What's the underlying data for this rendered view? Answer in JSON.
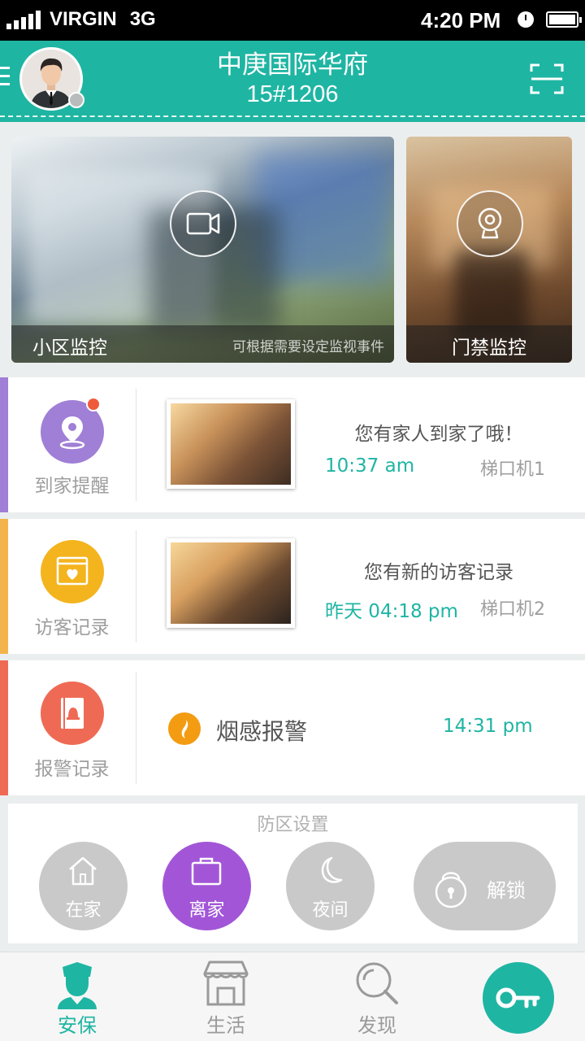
{
  "status_bar": {
    "carrier": "VIRGIN",
    "network": "3G",
    "time": "4:20 PM"
  },
  "header": {
    "title": "中庚国际华府",
    "subtitle": "15#1206"
  },
  "monitors": [
    {
      "label": "小区监控",
      "hint": "可根据需要设定监视事件"
    },
    {
      "label": "门禁监控"
    }
  ],
  "records": [
    {
      "category": "到家提醒",
      "message": "您有家人到家了哦！",
      "time": "10:37 am",
      "location": "梯口机1",
      "color": "#a07fd6",
      "stripe": "#a07fd6",
      "has_badge": true
    },
    {
      "category": "访客记录",
      "message": "您有新的访客记录",
      "time": "昨天 04:18 pm",
      "location": "梯口机2",
      "color": "#f4b41e",
      "stripe": "#f4b44c"
    },
    {
      "category": "报警记录",
      "message": "烟感报警",
      "time": "14:31 pm",
      "color": "#ef6a55",
      "stripe": "#ef6a55",
      "alarm_icon_color": "#f39c12"
    }
  ],
  "zone": {
    "title": "防区设置",
    "buttons": [
      {
        "label": "在家",
        "icon": "house-icon",
        "active": false
      },
      {
        "label": "离家",
        "icon": "bag-icon",
        "active": true
      },
      {
        "label": "夜间",
        "icon": "moon-icon",
        "active": false
      }
    ],
    "unlock_label": "解锁"
  },
  "tabs": [
    {
      "label": "安保",
      "icon": "guard-icon",
      "active": true
    },
    {
      "label": "生活",
      "icon": "shop-icon"
    },
    {
      "label": "发现",
      "icon": "search-icon"
    }
  ],
  "key_button": {
    "icon": "key-icon"
  },
  "colors": {
    "accent": "#1fb5a3",
    "purple": "#a256d7",
    "gray_button": "#c9c9c9"
  }
}
